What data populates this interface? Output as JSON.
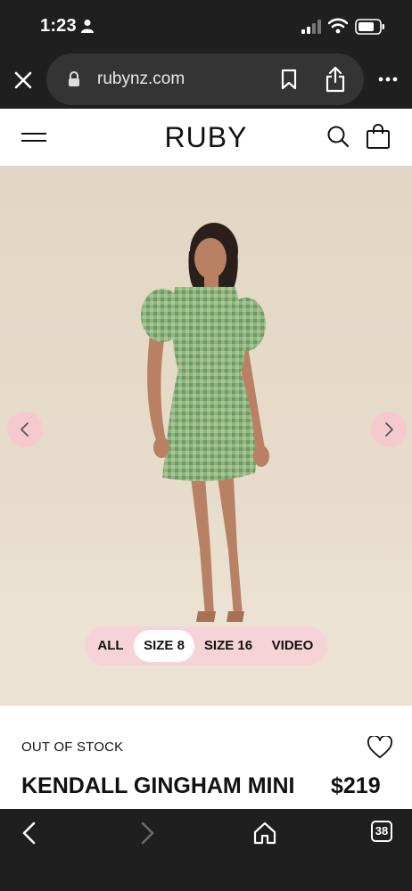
{
  "status_bar": {
    "time": "1:23"
  },
  "browser": {
    "url": "rubynz.com",
    "tab_count": "38"
  },
  "site": {
    "brand": "RUBY"
  },
  "gallery": {
    "filters": [
      {
        "label": "ALL",
        "active": false
      },
      {
        "label": "SIZE 8",
        "active": true
      },
      {
        "label": "SIZE 16",
        "active": false
      },
      {
        "label": "VIDEO",
        "active": false
      }
    ]
  },
  "product": {
    "stock_status": "OUT OF STOCK",
    "name": "KENDALL GINGHAM MINI",
    "price": "$219"
  },
  "colors": {
    "accent_pink": "#f6c9cf",
    "dress_green": "#88b07a",
    "chrome_dark": "#1f1f1f"
  },
  "icons": [
    "person-icon",
    "signal-icon",
    "wifi-icon",
    "battery-icon",
    "close-icon",
    "lock-icon",
    "bookmark-icon",
    "share-icon",
    "more-icon",
    "menu-icon",
    "search-icon",
    "bag-icon",
    "chevron-left-icon",
    "chevron-right-icon",
    "heart-icon",
    "back-icon",
    "forward-icon",
    "home-icon",
    "tabs-icon"
  ]
}
